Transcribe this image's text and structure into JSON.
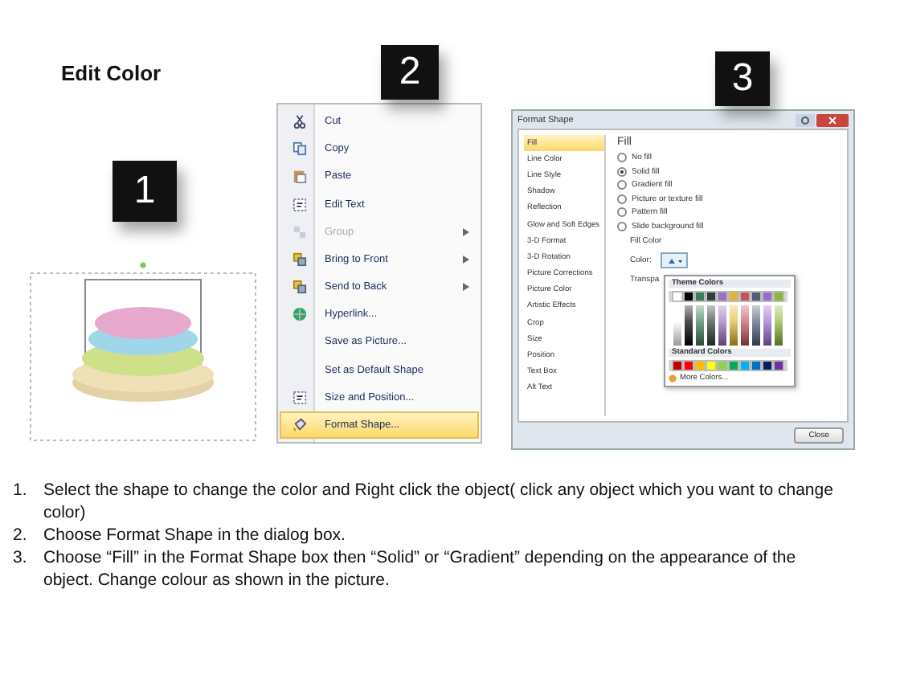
{
  "title": "Edit Color",
  "badges": [
    "1",
    "2",
    "3"
  ],
  "context_menu": {
    "items": [
      {
        "label": "Cut",
        "disabled": false,
        "submenu": false,
        "selected": false
      },
      {
        "label": "Copy",
        "disabled": false,
        "submenu": false,
        "selected": false
      },
      {
        "label": "Paste",
        "disabled": false,
        "submenu": false,
        "selected": false
      },
      {
        "label": "Edit Text",
        "disabled": false,
        "submenu": false,
        "selected": false
      },
      {
        "label": "Group",
        "disabled": true,
        "submenu": true,
        "selected": false
      },
      {
        "label": "Bring to Front",
        "disabled": false,
        "submenu": true,
        "selected": false
      },
      {
        "label": "Send to Back",
        "disabled": false,
        "submenu": true,
        "selected": false
      },
      {
        "label": "Hyperlink...",
        "disabled": false,
        "submenu": false,
        "selected": false
      },
      {
        "label": "Save as Picture...",
        "disabled": false,
        "submenu": false,
        "selected": false
      },
      {
        "label": "Set as Default Shape",
        "disabled": false,
        "submenu": false,
        "selected": false
      },
      {
        "label": "Size and Position...",
        "disabled": false,
        "submenu": false,
        "selected": false
      },
      {
        "label": "Format Shape...",
        "disabled": false,
        "submenu": false,
        "selected": true
      }
    ]
  },
  "dialog": {
    "title": "Format Shape",
    "categories": [
      {
        "label": "Fill",
        "selected": true
      },
      {
        "label": "Line Color",
        "selected": false
      },
      {
        "label": "Line Style",
        "selected": false
      },
      {
        "label": "Shadow",
        "selected": false
      },
      {
        "label": "Reflection",
        "selected": false
      },
      {
        "label": "Glow and Soft Edges",
        "selected": false
      },
      {
        "label": "3-D Format",
        "selected": false
      },
      {
        "label": "3-D Rotation",
        "selected": false
      },
      {
        "label": "Picture Corrections",
        "selected": false
      },
      {
        "label": "Picture Color",
        "selected": false
      },
      {
        "label": "Artistic Effects",
        "selected": false
      },
      {
        "label": "Crop",
        "selected": false
      },
      {
        "label": "Size",
        "selected": false
      },
      {
        "label": "Position",
        "selected": false
      },
      {
        "label": "Text Box",
        "selected": false
      },
      {
        "label": "Alt Text",
        "selected": false
      }
    ],
    "heading": "Fill",
    "options": [
      {
        "label": "No fill",
        "selected": false
      },
      {
        "label": "Solid fill",
        "selected": true
      },
      {
        "label": "Gradient fill",
        "selected": false
      },
      {
        "label": "Picture or texture fill",
        "selected": false
      },
      {
        "label": "Pattern fill",
        "selected": false
      },
      {
        "label": "Slide background fill",
        "selected": false
      }
    ],
    "group_label": "Fill Color",
    "color_label": "Color:",
    "transparency_label": "Transpa",
    "palette": {
      "theme_heading": "Theme Colors",
      "theme_colors": [
        {
          "color": "#ffffff"
        },
        {
          "color": "#000000"
        },
        {
          "color": "#3a7d5a"
        },
        {
          "color": "#2f3f3a"
        },
        {
          "color": "#9a6fc0"
        },
        {
          "color": "#e0b531"
        },
        {
          "color": "#c8505a"
        },
        {
          "color": "#4f5a78"
        },
        {
          "color": "#9a6ad0"
        },
        {
          "color": "#8cb83a"
        }
      ],
      "standard_heading": "Standard Colors",
      "standard_colors": [
        {
          "color": "#c00000"
        },
        {
          "color": "#ff0000"
        },
        {
          "color": "#ffc000"
        },
        {
          "color": "#ffff00"
        },
        {
          "color": "#92d050"
        },
        {
          "color": "#00b050"
        },
        {
          "color": "#00b0f0"
        },
        {
          "color": "#0070c0"
        },
        {
          "color": "#002060"
        },
        {
          "color": "#7030a0"
        }
      ],
      "more": "More Colors..."
    },
    "close": "Close"
  },
  "steps": [
    {
      "number": "1.",
      "text": "Select the shape to change the color and Right click the object( click any object which you want to change color)"
    },
    {
      "number": "2.",
      "text": "Choose Format Shape in the dialog box."
    },
    {
      "number": "3.",
      "text": "Choose “Fill” in the Format Shape box then “Solid” or “Gradient” depending on the appearance of the object. Change colour as shown in the picture."
    }
  ]
}
